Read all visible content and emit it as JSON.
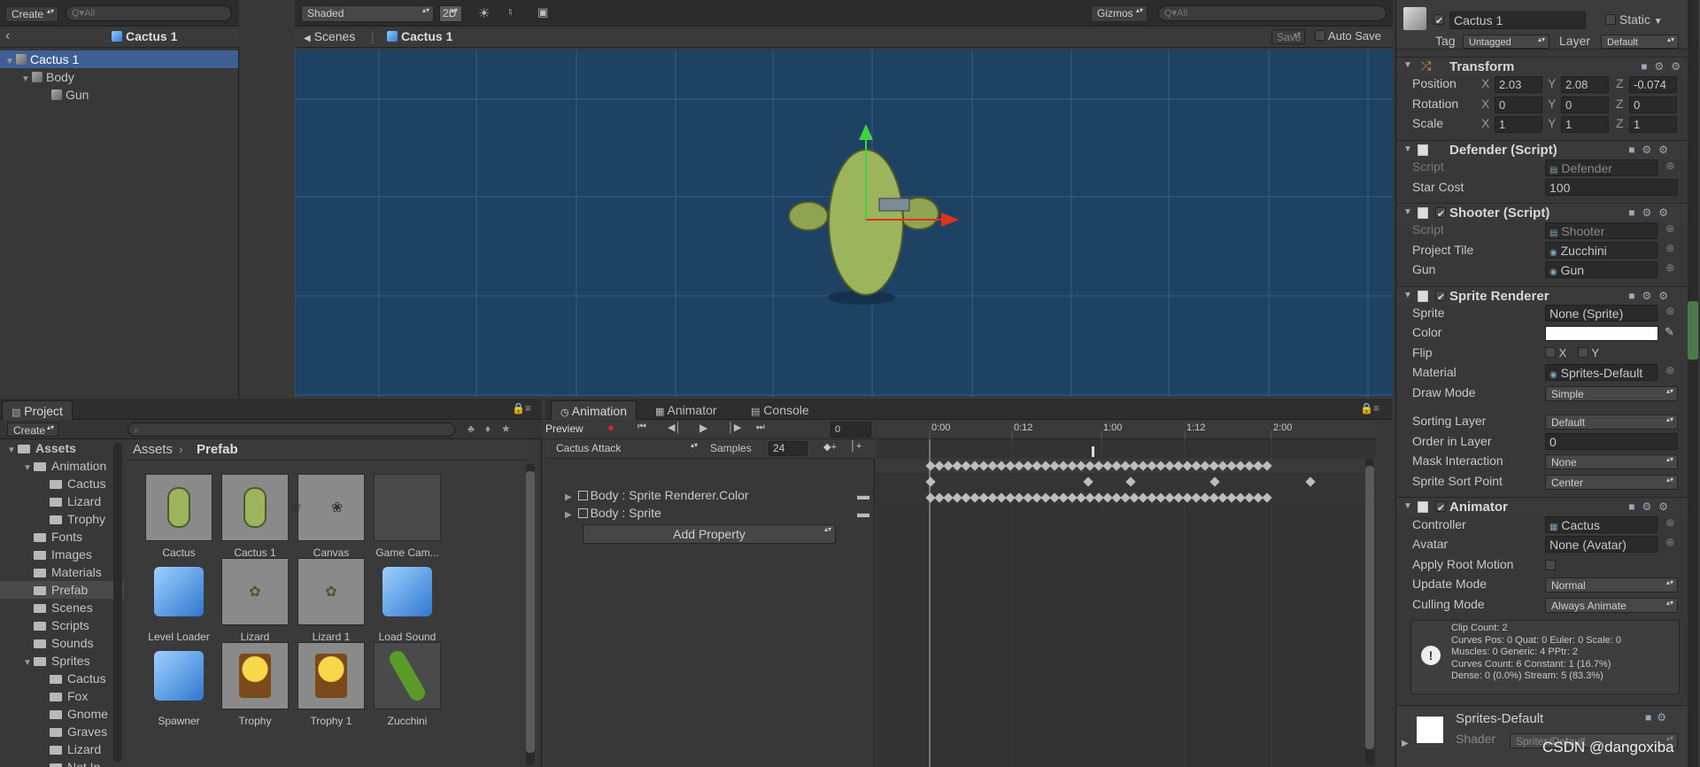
{
  "hierarchy": {
    "create": "Create",
    "search_placeholder": "Q▾All",
    "scene_title": "Cactus 1",
    "items": [
      {
        "label": "Cactus 1",
        "depth": 0
      },
      {
        "label": "Body",
        "depth": 1
      },
      {
        "label": "Gun",
        "depth": 2
      }
    ]
  },
  "scene": {
    "shading": "Shaded",
    "mode_2d": "2D",
    "gizmos": "Gizmos",
    "search_placeholder": "Q▾All",
    "breadcrumb_root": "Scenes",
    "breadcrumb_item": "Cactus 1",
    "save": "Save",
    "auto_save": "Auto Save"
  },
  "project": {
    "tab": "Project",
    "create": "Create",
    "breadcrumb_root": "Assets",
    "breadcrumb_current": "Prefab",
    "tree": [
      {
        "label": "Assets",
        "depth": 0,
        "bold": true
      },
      {
        "label": "Animation",
        "depth": 1
      },
      {
        "label": "Cactus",
        "depth": 2
      },
      {
        "label": "Lizard",
        "depth": 2
      },
      {
        "label": "Trophy",
        "depth": 2
      },
      {
        "label": "Fonts",
        "depth": 1
      },
      {
        "label": "Images",
        "depth": 1
      },
      {
        "label": "Materials",
        "depth": 1
      },
      {
        "label": "Prefab",
        "depth": 1,
        "selected": true
      },
      {
        "label": "Scenes",
        "depth": 1
      },
      {
        "label": "Scripts",
        "depth": 1
      },
      {
        "label": "Sounds",
        "depth": 1
      },
      {
        "label": "Sprites",
        "depth": 1
      },
      {
        "label": "Cactus",
        "depth": 2
      },
      {
        "label": "Fox",
        "depth": 2
      },
      {
        "label": "Gnome",
        "depth": 2
      },
      {
        "label": "Graves",
        "depth": 2
      },
      {
        "label": "Lizard",
        "depth": 2
      },
      {
        "label": "Not In",
        "depth": 2
      }
    ],
    "assets": [
      {
        "name": "Cactus",
        "kind": "cactus"
      },
      {
        "name": "Cactus 1",
        "kind": "cactus"
      },
      {
        "name": "Canvas",
        "kind": "canvas"
      },
      {
        "name": "Game Cam...",
        "kind": "dark"
      },
      {
        "name": "Level Loader",
        "kind": "cube"
      },
      {
        "name": "Lizard",
        "kind": "lizard"
      },
      {
        "name": "Lizard 1",
        "kind": "lizard"
      },
      {
        "name": "Load Sound",
        "kind": "cube"
      },
      {
        "name": "Spawner",
        "kind": "cube"
      },
      {
        "name": "Trophy",
        "kind": "trophy"
      },
      {
        "name": "Trophy 1",
        "kind": "trophy"
      },
      {
        "name": "Zucchini",
        "kind": "zucchini"
      }
    ]
  },
  "animation": {
    "tabs": [
      "Animation",
      "Animator",
      "Console"
    ],
    "preview": "Preview",
    "frame": "0",
    "clip": "Cactus Attack",
    "samples_label": "Samples",
    "samples": "24",
    "properties": [
      "Body : Sprite Renderer.Color",
      "Body : Sprite"
    ],
    "add_property": "Add Property",
    "time_labels": [
      "0:00",
      "0:12",
      "1:00",
      "1:12",
      "2:00"
    ]
  },
  "inspector": {
    "object_name": "Cactus 1",
    "static_label": "Static",
    "tag_label": "Tag",
    "tag": "Untagged",
    "layer_label": "Layer",
    "layer": "Default",
    "transform": {
      "title": "Transform",
      "position_label": "Position",
      "rotation_label": "Rotation",
      "scale_label": "Scale",
      "position": [
        "2.03",
        "2.08",
        "-0.074"
      ],
      "rotation": [
        "0",
        "0",
        "0"
      ],
      "scale": [
        "1",
        "1",
        "1"
      ]
    },
    "defender": {
      "title": "Defender (Script)",
      "script_label": "Script",
      "script": "Defender",
      "star_cost_label": "Star Cost",
      "star_cost": "100"
    },
    "shooter": {
      "title": "Shooter (Script)",
      "script_label": "Script",
      "script": "Shooter",
      "project_tile_label": "Project Tile",
      "project_tile": "Zucchini",
      "gun_label": "Gun",
      "gun": "Gun"
    },
    "sprite_renderer": {
      "title": "Sprite Renderer",
      "sprite_label": "Sprite",
      "sprite": "None (Sprite)",
      "color_label": "Color",
      "flip_label": "Flip",
      "flip_x": "X",
      "flip_y": "Y",
      "material_label": "Material",
      "material": "Sprites-Default",
      "draw_mode_label": "Draw Mode",
      "draw_mode": "Simple",
      "sorting_layer_label": "Sorting Layer",
      "sorting_layer": "Default",
      "order_label": "Order in Layer",
      "order": "0",
      "mask_label": "Mask Interaction",
      "mask": "None",
      "sort_point_label": "Sprite Sort Point",
      "sort_point": "Center"
    },
    "animator": {
      "title": "Animator",
      "controller_label": "Controller",
      "controller": "Cactus",
      "avatar_label": "Avatar",
      "avatar": "None (Avatar)",
      "root_motion_label": "Apply Root Motion",
      "update_mode_label": "Update Mode",
      "update_mode": "Normal",
      "culling_label": "Culling Mode",
      "culling": "Always Animate",
      "info": [
        "Clip Count: 2",
        "Curves Pos: 0 Quat: 0 Euler: 0 Scale: 0",
        "Muscles: 0 Generic: 4 PPtr: 2",
        "Curves Count: 6 Constant: 1 (16.7%)",
        "Dense: 0 (0.0%) Stream: 5 (83.3%)"
      ]
    },
    "material": {
      "title": "Sprites-Default",
      "shader_label": "Shader",
      "shader": "Sprites/Default"
    }
  },
  "watermark": "CSDN @dangoxiba",
  "colors": {
    "scene_bg": "#1e4263",
    "selection": "#3e5f96",
    "cactus": "#8fa452",
    "arrow_green": "#3fd43f",
    "arrow_red": "#e0331d"
  }
}
